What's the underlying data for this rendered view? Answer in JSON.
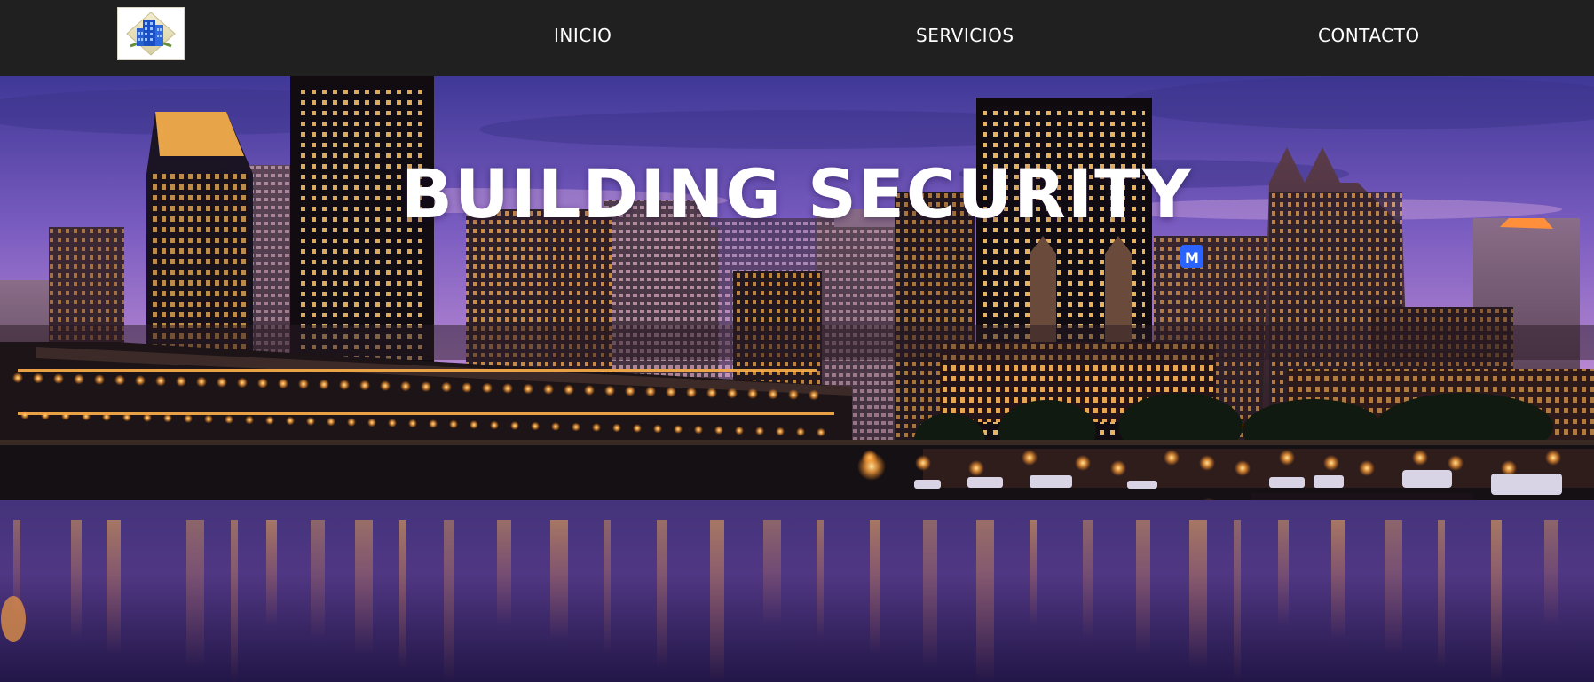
{
  "nav": {
    "logo_alt": "building-logo",
    "items": [
      {
        "label": "INICIO"
      },
      {
        "label": "SERVICIOS"
      },
      {
        "label": "CONTACTO"
      }
    ]
  },
  "hero": {
    "title": "BUILDING SECURITY",
    "background": "night-city-skyline-waterfront"
  },
  "colors": {
    "navbar_bg": "#202020",
    "nav_text": "#ffffff",
    "hero_title": "#ffffff",
    "sky_top": "#4a3f9a",
    "sky_mid": "#9b6fc6",
    "sky_horizon": "#d99ac8",
    "water": "#2a1e5a",
    "lights": "#ffb347"
  }
}
